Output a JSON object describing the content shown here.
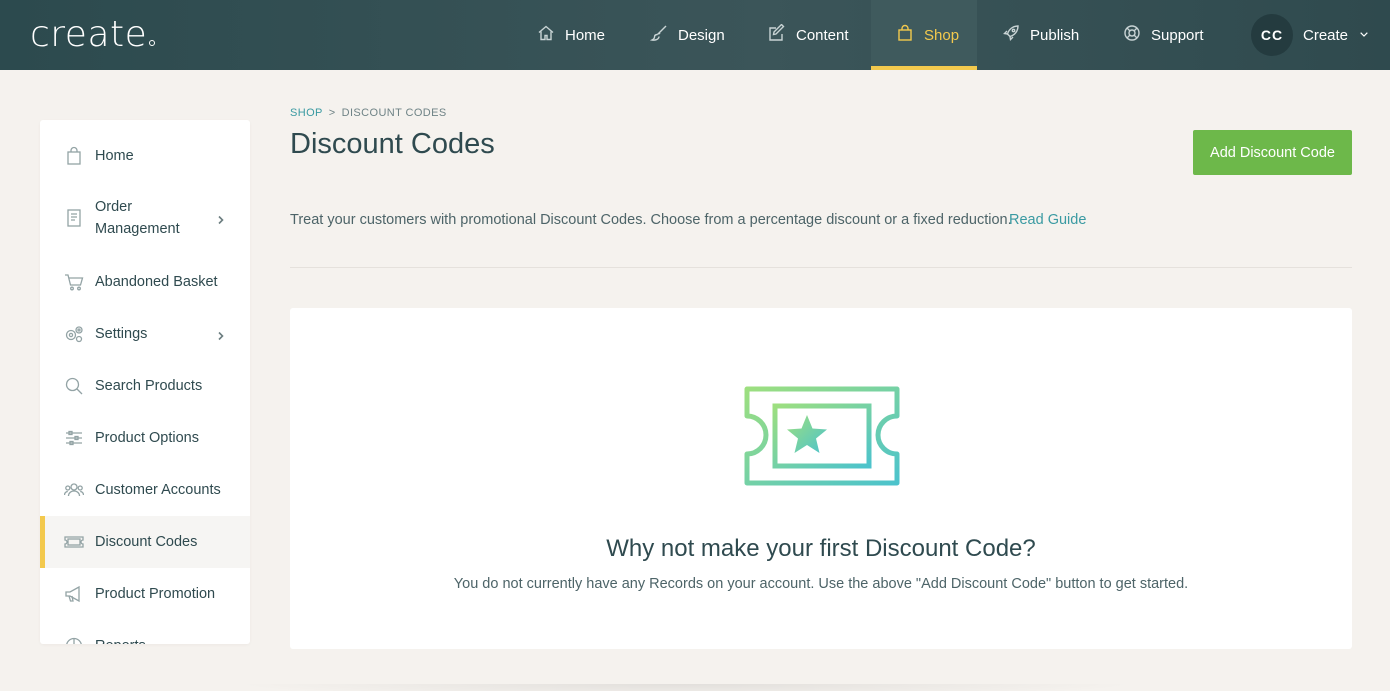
{
  "brand": {
    "logo_text": "create"
  },
  "topnav": {
    "items": [
      {
        "label": "Home",
        "icon": "home-icon"
      },
      {
        "label": "Design",
        "icon": "brush-icon"
      },
      {
        "label": "Content",
        "icon": "edit-icon"
      },
      {
        "label": "Shop",
        "icon": "shopping-bag-icon",
        "active": true
      },
      {
        "label": "Publish",
        "icon": "rocket-icon"
      },
      {
        "label": "Support",
        "icon": "lifebuoy-icon"
      }
    ],
    "account": {
      "initials": "CC",
      "label": "Create"
    }
  },
  "sidebar": {
    "items": [
      {
        "label": "Home",
        "icon": "shopping-bag-icon"
      },
      {
        "label": "Order Management",
        "icon": "receipt-icon",
        "has_submenu": true
      },
      {
        "label": "Abandoned Basket",
        "icon": "cart-icon"
      },
      {
        "label": "Settings",
        "icon": "gears-icon",
        "has_submenu": true
      },
      {
        "label": "Search Products",
        "icon": "search-icon"
      },
      {
        "label": "Product Options",
        "icon": "sliders-icon"
      },
      {
        "label": "Customer Accounts",
        "icon": "users-icon"
      },
      {
        "label": "Discount Codes",
        "icon": "ticket-icon",
        "active": true
      },
      {
        "label": "Product Promotion",
        "icon": "megaphone-icon"
      },
      {
        "label": "Reports",
        "icon": "pie-chart-icon"
      }
    ]
  },
  "breadcrumb": {
    "parent": "SHOP",
    "separator": ">",
    "current": "DISCOUNT CODES"
  },
  "page": {
    "title": "Discount Codes",
    "add_button": "Add Discount Code",
    "intro": "Treat your customers with promotional Discount Codes. Choose from a percentage discount or a fixed reduction.",
    "guide_link": "Read Guide"
  },
  "empty_state": {
    "title": "Why not make your first Discount Code?",
    "message": "You do not currently have any Records on your account. Use the above \"Add Discount Code\" button to get started."
  },
  "colors": {
    "accent": "#f3c94d",
    "primary_button": "#6db84a",
    "link": "#3a9aa2",
    "topbar": "#2f4a4e"
  }
}
